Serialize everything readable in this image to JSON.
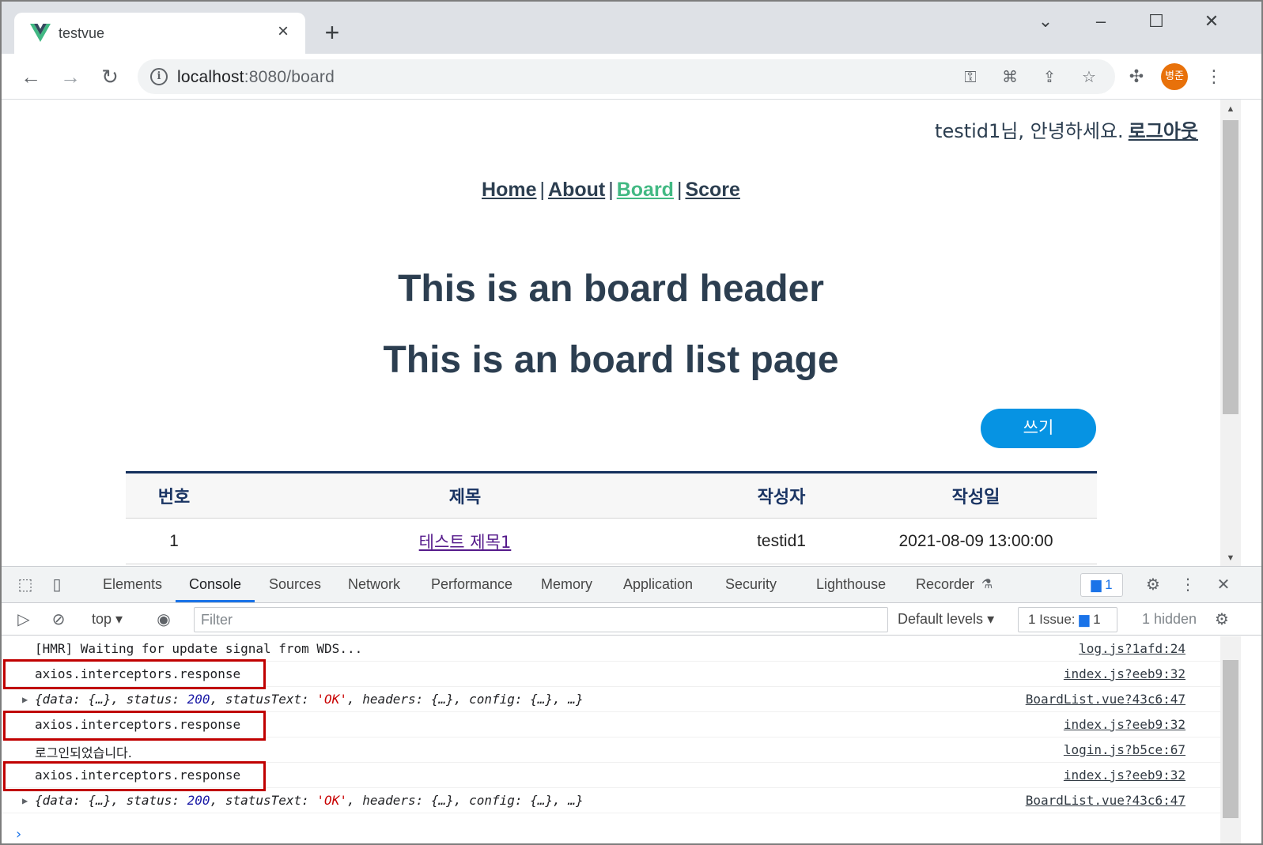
{
  "browser": {
    "tab_title": "testvue",
    "url_host": "localhost",
    "url_rest": ":8080/board",
    "profile_initials": "병준"
  },
  "page": {
    "greeting": "testid1님, 안녕하세요.",
    "logout_label": "로그아웃",
    "nav": [
      {
        "label": "Home"
      },
      {
        "label": "About"
      },
      {
        "label": "Board"
      },
      {
        "label": "Score"
      }
    ],
    "nav_separator": "|",
    "header_title": "This is an board header",
    "list_title": "This is an board list page",
    "write_button": "쓰기",
    "table": {
      "columns": [
        "번호",
        "제목",
        "작성자",
        "작성일"
      ],
      "rows": [
        {
          "no": "1",
          "title": "테스트 제목1",
          "writer": "testid1",
          "date": "2021-08-09 13:00:00"
        }
      ]
    },
    "accent_color": "#42b983",
    "button_color": "#0693e3"
  },
  "devtools": {
    "tabs": [
      "Elements",
      "Console",
      "Sources",
      "Network",
      "Performance",
      "Memory",
      "Application",
      "Security",
      "Lighthouse",
      "Recorder"
    ],
    "active_tab": "Console",
    "message_badge_count": "1",
    "context": "top",
    "filter_placeholder": "Filter",
    "levels": "Default levels",
    "issues_label": "1 Issue:",
    "issues_count": "1",
    "hidden_label": "1 hidden",
    "console": [
      {
        "text": "[HMR] Waiting for update signal from WDS...",
        "source": "log.js?1afd:24"
      },
      {
        "text": "axios.interceptors.response",
        "source": "index.js?eeb9:32"
      },
      {
        "obj_prefix": "{data: {…}, status: ",
        "status": "200",
        "obj_mid": ", statusText: ",
        "status_text": "'OK'",
        "obj_suffix": ", headers: {…}, config: {…}, …}",
        "source": "BoardList.vue?43c6:47"
      },
      {
        "text": "axios.interceptors.response",
        "source": "index.js?eeb9:32"
      },
      {
        "text": "로그인되었습니다.",
        "source": "login.js?b5ce:67"
      },
      {
        "text": "axios.interceptors.response",
        "source": "index.js?eeb9:32"
      },
      {
        "obj_prefix": "{data: {…}, status: ",
        "status": "200",
        "obj_mid": ", statusText: ",
        "status_text": "'OK'",
        "obj_suffix": ", headers: {…}, config: {…}, …}",
        "source": "BoardList.vue?43c6:47"
      }
    ],
    "highlight_color": "#c00000"
  }
}
